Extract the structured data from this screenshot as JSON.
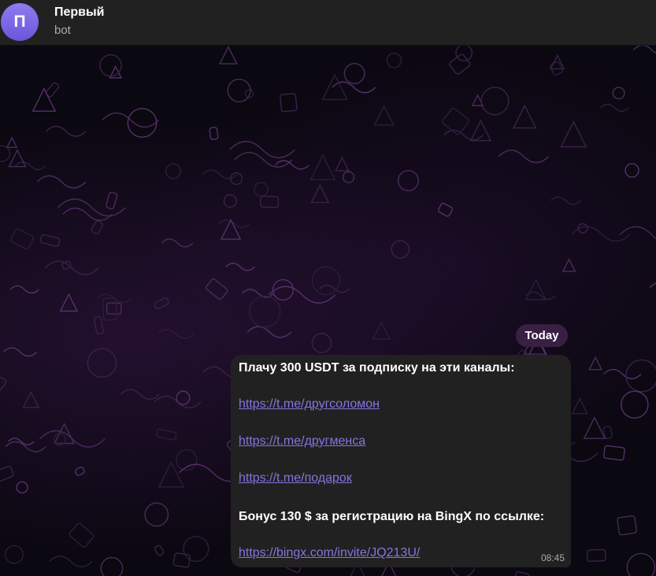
{
  "header": {
    "avatar_letter": "П",
    "title": "Первый",
    "subtitle": "bot"
  },
  "date_separator": "Today",
  "message": {
    "line1": "Плачу 300 USDT за подписку на эти каналы:",
    "link1": "https://t.me/другсоломон",
    "link2": "https://t.me/другменса",
    "link3": "https://t.me/подарок",
    "line2": "Бонус 130 $ за регистрацию на BingX по ссылке:",
    "link4": "https://bingx.com/invite/JQ213U/",
    "time": "08:45"
  },
  "colors": {
    "accent": "#8774e1",
    "header_bg": "#212121",
    "bubble_bg": "#212121",
    "date_pill_bg": "#3a1f45",
    "avatar_gradient_top": "#8e7cf0",
    "avatar_gradient_bottom": "#6c55d9"
  },
  "icons": {
    "background_pattern": "doodle-pattern"
  }
}
